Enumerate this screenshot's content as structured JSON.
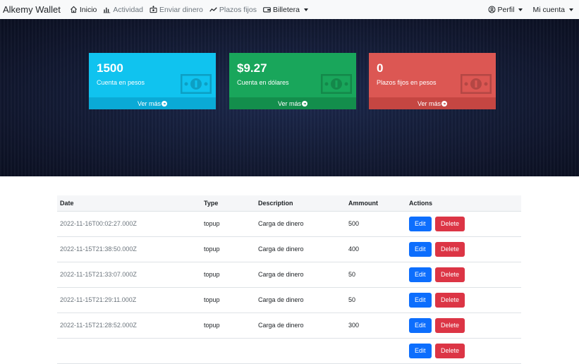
{
  "navbar": {
    "brand": "Alkemy Wallet",
    "links": [
      {
        "label": "Inicio",
        "icon": "home-icon"
      },
      {
        "label": "Actividad",
        "icon": "bar-chart-icon"
      },
      {
        "label": "Enviar dinero",
        "icon": "send-money-icon"
      },
      {
        "label": "Plazos fijos",
        "icon": "trend-line-icon"
      },
      {
        "label": "Billetera",
        "icon": "wallet-icon"
      }
    ],
    "profile_label": "Perfil",
    "account_label": "Mi cuenta"
  },
  "cards": [
    {
      "value": "1500",
      "label": "Cuenta en pesos",
      "footer": "Ver más",
      "color": "#10c3ef"
    },
    {
      "value": "$9.27",
      "label": "Cuenta en dólares",
      "footer": "Ver más",
      "color": "#19a65b"
    },
    {
      "value": "0",
      "label": "Plazos fijos en pesos",
      "footer": "Ver más",
      "color": "#dc5753"
    }
  ],
  "table": {
    "headers": [
      "Date",
      "Type",
      "Description",
      "Ammount",
      "Actions"
    ],
    "edit_label": "Edit",
    "delete_label": "Delete",
    "rows": [
      {
        "date": "2022-11-16T00:02:27.000Z",
        "type": "topup",
        "description": "Carga de dinero",
        "amount": "500"
      },
      {
        "date": "2022-11-15T21:38:50.000Z",
        "type": "topup",
        "description": "Carga de dinero",
        "amount": "400"
      },
      {
        "date": "2022-11-15T21:33:07.000Z",
        "type": "topup",
        "description": "Carga de dinero",
        "amount": "50"
      },
      {
        "date": "2022-11-15T21:29:11.000Z",
        "type": "topup",
        "description": "Carga de dinero",
        "amount": "50"
      },
      {
        "date": "2022-11-15T21:28:52.000Z",
        "type": "topup",
        "description": "Carga de dinero",
        "amount": "300"
      },
      {
        "date": "",
        "type": "",
        "description": "",
        "amount": ""
      }
    ]
  },
  "colors": {
    "primary": "#0d6efd",
    "danger": "#dc3545",
    "navbar_bg": "#f8f9fa",
    "hero_bg": "#121933"
  }
}
